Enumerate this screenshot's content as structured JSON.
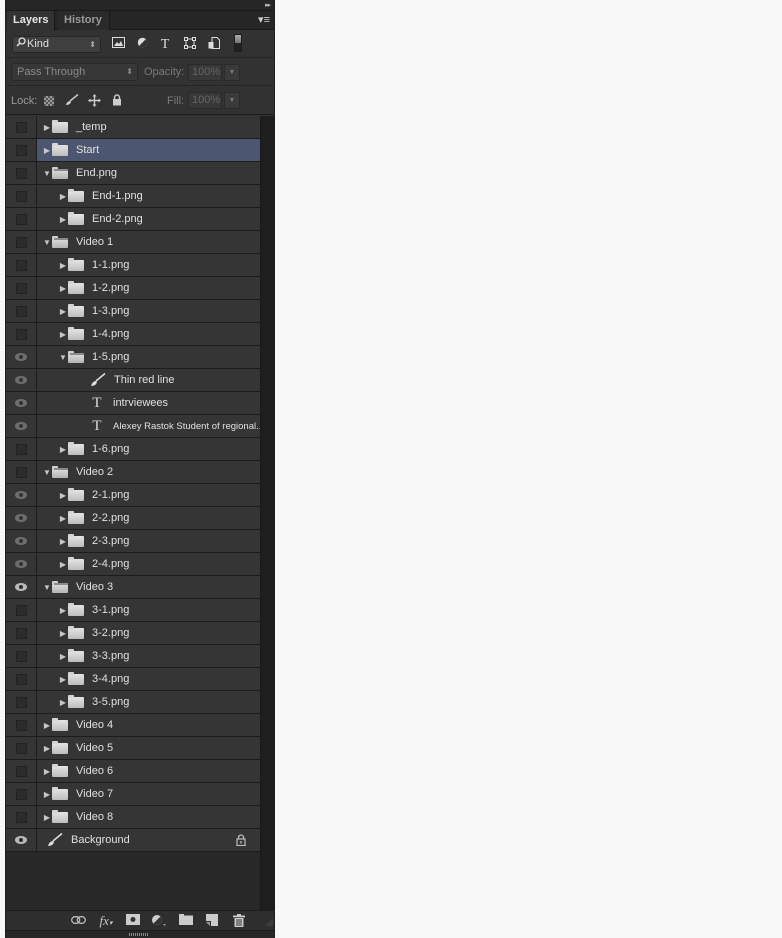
{
  "panel": {
    "collapse_glyph": "▸▸",
    "tabs": [
      {
        "label": "Layers",
        "active": true
      },
      {
        "label": "History",
        "active": false
      }
    ],
    "menu_glyph": "▾≡"
  },
  "filter": {
    "kind_label": "Kind",
    "kind_icon": "search-icon",
    "filter_icons": [
      "pixel-layer-filter-icon",
      "adjustment-layer-filter-icon",
      "type-layer-filter-icon",
      "shape-layer-filter-icon",
      "smart-object-filter-icon"
    ],
    "type_glyph": "T"
  },
  "blend": {
    "mode": "Pass Through",
    "opacity_label": "Opacity:",
    "opacity_value": "100%"
  },
  "lock": {
    "label": "Lock:",
    "fill_label": "Fill:",
    "fill_value": "100%"
  },
  "layers": [
    {
      "name": "_temp",
      "kind": "group",
      "expanded": false,
      "depth": 0,
      "visibility": "hidden",
      "selected": false
    },
    {
      "name": "Start",
      "kind": "group",
      "expanded": false,
      "depth": 0,
      "visibility": "hidden",
      "selected": true
    },
    {
      "name": "End.png",
      "kind": "group",
      "expanded": true,
      "depth": 0,
      "visibility": "hidden",
      "selected": false
    },
    {
      "name": "End-1.png",
      "kind": "group",
      "expanded": false,
      "depth": 1,
      "visibility": "hidden",
      "selected": false
    },
    {
      "name": "End-2.png",
      "kind": "group",
      "expanded": false,
      "depth": 1,
      "visibility": "hidden",
      "selected": false
    },
    {
      "name": "Video 1",
      "kind": "group",
      "expanded": true,
      "depth": 0,
      "visibility": "hidden",
      "selected": false
    },
    {
      "name": "1-1.png",
      "kind": "group",
      "expanded": false,
      "depth": 1,
      "visibility": "hidden",
      "selected": false
    },
    {
      "name": "1-2.png",
      "kind": "group",
      "expanded": false,
      "depth": 1,
      "visibility": "hidden",
      "selected": false
    },
    {
      "name": "1-3.png",
      "kind": "group",
      "expanded": false,
      "depth": 1,
      "visibility": "hidden",
      "selected": false
    },
    {
      "name": "1-4.png",
      "kind": "group",
      "expanded": false,
      "depth": 1,
      "visibility": "hidden",
      "selected": false
    },
    {
      "name": "1-5.png",
      "kind": "group",
      "expanded": true,
      "depth": 1,
      "visibility": "dim",
      "selected": false
    },
    {
      "name": "Thin red line",
      "kind": "pixel",
      "depth": 2,
      "visibility": "dim",
      "selected": false
    },
    {
      "name": "intrviewees",
      "kind": "text",
      "depth": 2,
      "visibility": "dim",
      "selected": false
    },
    {
      "name": "Alexey Rastok Student of regional...",
      "kind": "text",
      "depth": 2,
      "visibility": "dim",
      "selected": false,
      "small": true
    },
    {
      "name": "1-6.png",
      "kind": "group",
      "expanded": false,
      "depth": 1,
      "visibility": "hidden",
      "selected": false
    },
    {
      "name": "Video 2",
      "kind": "group",
      "expanded": true,
      "depth": 0,
      "visibility": "hidden",
      "selected": false
    },
    {
      "name": "2-1.png",
      "kind": "group",
      "expanded": false,
      "depth": 1,
      "visibility": "dim",
      "selected": false
    },
    {
      "name": "2-2.png",
      "kind": "group",
      "expanded": false,
      "depth": 1,
      "visibility": "dim",
      "selected": false
    },
    {
      "name": "2-3.png",
      "kind": "group",
      "expanded": false,
      "depth": 1,
      "visibility": "dim",
      "selected": false
    },
    {
      "name": "2-4.png",
      "kind": "group",
      "expanded": false,
      "depth": 1,
      "visibility": "dim",
      "selected": false
    },
    {
      "name": "Video 3",
      "kind": "group",
      "expanded": true,
      "depth": 0,
      "visibility": "visible",
      "selected": false
    },
    {
      "name": "3-1.png",
      "kind": "group",
      "expanded": false,
      "depth": 1,
      "visibility": "hidden",
      "selected": false
    },
    {
      "name": "3-2.png",
      "kind": "group",
      "expanded": false,
      "depth": 1,
      "visibility": "hidden",
      "selected": false
    },
    {
      "name": "3-3.png",
      "kind": "group",
      "expanded": false,
      "depth": 1,
      "visibility": "hidden",
      "selected": false
    },
    {
      "name": "3-4.png",
      "kind": "group",
      "expanded": false,
      "depth": 1,
      "visibility": "hidden",
      "selected": false
    },
    {
      "name": "3-5.png",
      "kind": "group",
      "expanded": false,
      "depth": 1,
      "visibility": "hidden",
      "selected": false
    },
    {
      "name": "Video 4",
      "kind": "group",
      "expanded": false,
      "depth": 0,
      "visibility": "hidden",
      "selected": false
    },
    {
      "name": "Video 5",
      "kind": "group",
      "expanded": false,
      "depth": 0,
      "visibility": "hidden",
      "selected": false
    },
    {
      "name": "Video 6",
      "kind": "group",
      "expanded": false,
      "depth": 0,
      "visibility": "hidden",
      "selected": false
    },
    {
      "name": "Video 7",
      "kind": "group",
      "expanded": false,
      "depth": 0,
      "visibility": "hidden",
      "selected": false
    },
    {
      "name": "Video 8",
      "kind": "group",
      "expanded": false,
      "depth": 0,
      "visibility": "hidden",
      "selected": false
    },
    {
      "name": "Background",
      "kind": "pixel",
      "depth": -1,
      "visibility": "visible",
      "selected": false,
      "locked": true
    }
  ],
  "bottom_toolbar": [
    {
      "name": "link-layers-icon",
      "glyph": "⊖"
    },
    {
      "name": "layer-style-fx-icon",
      "glyph": "fx"
    },
    {
      "name": "add-mask-icon",
      "glyph": ""
    },
    {
      "name": "adjustment-layer-icon",
      "glyph": ""
    },
    {
      "name": "new-group-icon",
      "glyph": ""
    },
    {
      "name": "new-layer-icon",
      "glyph": ""
    },
    {
      "name": "delete-layer-icon",
      "glyph": "🗑"
    }
  ],
  "colors": {
    "panel_bg": "#323232",
    "row_bg": "#353535",
    "selected_row": "#4c5670",
    "text": "#e0e0e0"
  }
}
